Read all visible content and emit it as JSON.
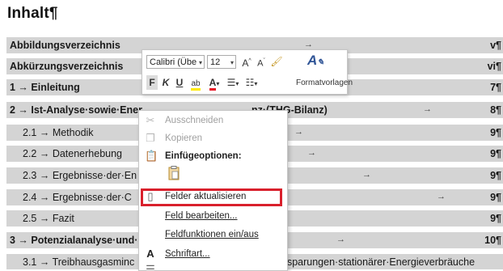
{
  "heading": "Inhalt¶",
  "toc": [
    {
      "label": "Abbildungsverzeichnis",
      "page": "v¶",
      "type": "main"
    },
    {
      "label": "Abkürzungsverzeichnis",
      "page": "vi¶",
      "type": "main"
    },
    {
      "label": "1 → Einleitung",
      "page": "7¶",
      "type": "main"
    },
    {
      "label": "2 → Ist-Analyse·sowie·Ener",
      "tail": "nz·(THG-Bilanz)",
      "page": "8¶",
      "type": "main"
    },
    {
      "label": "2.1 → Methodik",
      "page": "9¶",
      "type": "sub"
    },
    {
      "label": "2.2 → Datenerhebung",
      "page": "9¶",
      "type": "sub"
    },
    {
      "label": "2.3 → Ergebnisse·der·En",
      "page": "9¶",
      "type": "sub"
    },
    {
      "label": "2.4 → Ergebnisse·der·C",
      "page": "9¶",
      "type": "sub"
    },
    {
      "label": "2.5 → Fazit",
      "page": "9¶",
      "type": "sub"
    },
    {
      "label": "3 → Potenzialanalyse·und·S",
      "page": "10¶",
      "type": "main"
    },
    {
      "label": "3.1 → Treibhausgasminc",
      "tail": "nsparungen·stationärer·Energieverbräuche",
      "page": "",
      "type": "sub"
    }
  ],
  "mini_toolbar": {
    "font": "Calibri (Übe",
    "size": "12",
    "bold": "F",
    "italic": "K",
    "underline": "U",
    "styles_label": "Formatvorlagen"
  },
  "context_menu": {
    "items": [
      {
        "label": "Ausschneiden",
        "icon": "scissors-icon",
        "state": "disabled"
      },
      {
        "label": "Kopieren",
        "icon": "copy-icon",
        "state": "disabled"
      },
      {
        "label": "Einfügeoptionen:",
        "icon": "paste-icon",
        "state": "header"
      },
      {
        "label": "Felder aktualisieren",
        "icon": "update-fields-icon",
        "state": "highlighted"
      },
      {
        "label": "Feld bearbeiten...",
        "icon": "",
        "state": "normal"
      },
      {
        "label": "Feldfunktionen ein/aus",
        "icon": "",
        "state": "normal"
      },
      {
        "label": "Schriftart...",
        "icon": "font-icon",
        "state": "normal"
      },
      {
        "label": "",
        "icon": "paragraph-icon",
        "state": "normal"
      }
    ]
  },
  "colors": {
    "highlight_border": "#d9202c",
    "toc_field_shading": "#d4d4d4"
  }
}
